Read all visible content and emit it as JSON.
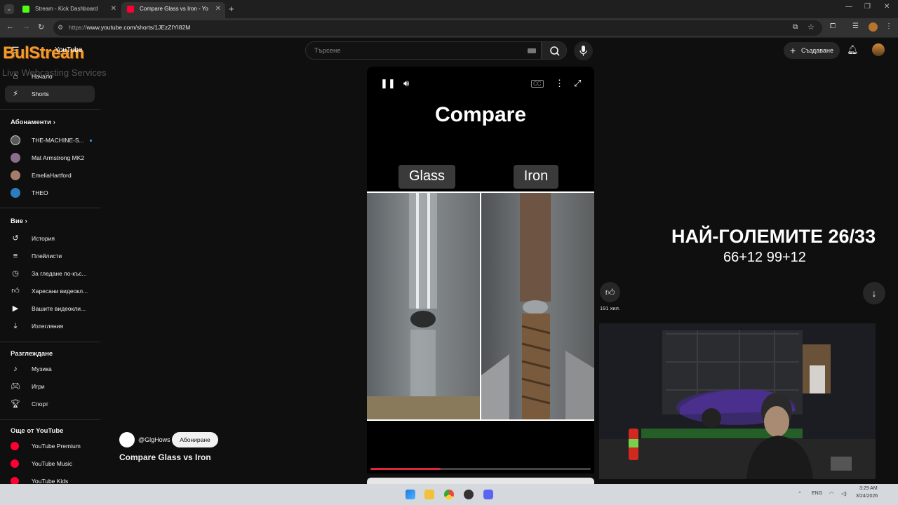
{
  "browser": {
    "tabs": [
      {
        "title": "Stream - Kick Dashboard"
      },
      {
        "title": "Compare Glass vs Iron - Yo"
      }
    ],
    "url_prefix": "https://",
    "url_main": "www.youtube.com/shorts/1JEzZIYI82M"
  },
  "logo": {
    "text": "BulStream",
    "tagline": "Live Webcasting Services",
    "yt_text": "YouTube"
  },
  "header": {
    "search_placeholder": "Търсене",
    "create_label": "Създаване"
  },
  "sidebar": {
    "main": [
      {
        "label": "Начало",
        "icon": "home-icon"
      },
      {
        "label": "Shorts",
        "icon": "shorts-icon"
      }
    ],
    "subscriptions_heading": "Абонаменти",
    "subscriptions": [
      {
        "label": "THE-MACHINE-S...",
        "color": "#5a5a5a"
      },
      {
        "label": "Mat Armstrong MK2",
        "color": "#8a6f8c"
      },
      {
        "label": "EmeliaHartford",
        "color": "#a47c6a"
      },
      {
        "label": "THEO",
        "color": "#2b7dbd"
      }
    ],
    "you_heading": "Вие",
    "you": [
      {
        "label": "История",
        "icon": "history-icon"
      },
      {
        "label": "Плейлисти",
        "icon": "playlist-icon"
      },
      {
        "label": "За гледане по-къс...",
        "icon": "clock-icon"
      },
      {
        "label": "Харесани видеокл...",
        "icon": "thumbs-up-icon"
      },
      {
        "label": "Вашите видеокли...",
        "icon": "video-icon"
      },
      {
        "label": "Изтегляния",
        "icon": "download-icon"
      }
    ],
    "explore_heading": "Разглеждане",
    "explore": [
      {
        "label": "Музика",
        "icon": "music-icon"
      },
      {
        "label": "Игри",
        "icon": "gamepad-icon"
      },
      {
        "label": "Спорт",
        "icon": "trophy-icon"
      }
    ],
    "more_heading": "Още от YouTube",
    "more": [
      {
        "label": "YouTube Premium"
      },
      {
        "label": "YouTube Music"
      },
      {
        "label": "YouTube Kids"
      }
    ]
  },
  "video": {
    "heading": "Compare",
    "left_label": "Glass",
    "right_label": "Iron",
    "progress": 0.32,
    "channel": "@GlgHows",
    "subscribe": "Абониране",
    "title": "Compare Glass vs Iron",
    "likes": "191 хил."
  },
  "overlay": {
    "title": "НАЙ-ГОЛЕМИТЕ 26/33",
    "subtitle": "66+12 99+12"
  },
  "taskbar": {
    "lang": "ENG",
    "time": "3:29 AM",
    "date": "3/24/2026"
  },
  "colors": {
    "accent_red": "#e0263c",
    "logo_orange": "#f29a2e"
  }
}
